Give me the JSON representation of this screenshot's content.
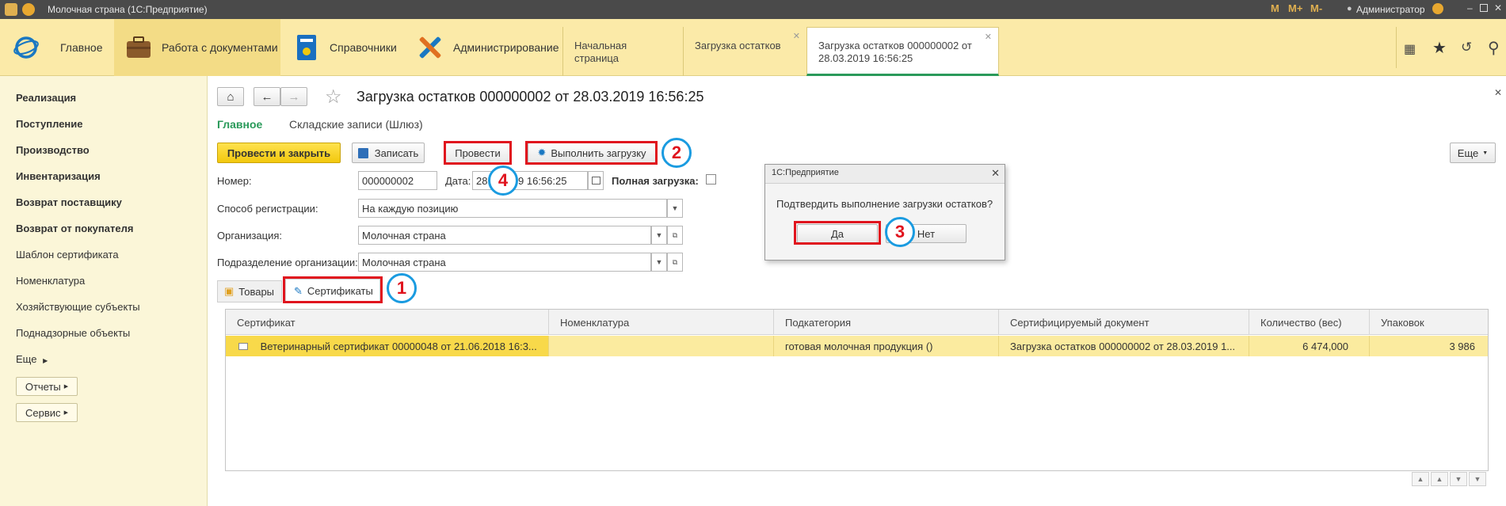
{
  "window": {
    "title": "Молочная страна  (1С:Предприятие)",
    "user": "Администратор",
    "toolbar_m": [
      "M",
      "M+",
      "M-"
    ]
  },
  "sections": [
    {
      "label": "Главное",
      "icon": "1c-logo-icon"
    },
    {
      "label": "Работа с документами",
      "icon": "briefcase-icon"
    },
    {
      "label": "Справочники",
      "icon": "reference-book-icon"
    },
    {
      "label": "Администрирование",
      "icon": "tools-icon"
    }
  ],
  "open_tabs": [
    {
      "label": "Начальная страница"
    },
    {
      "label": "Загрузка остатков"
    },
    {
      "label_line1": "Загрузка остатков 000000002 от",
      "label_line2": "28.03.2019 16:56:25"
    }
  ],
  "nav": {
    "items": [
      "Реализация",
      "Поступление",
      "Производство",
      "Инвентаризация",
      "Возврат поставщику",
      "Возврат от покупателя",
      "Шаблон сертификата",
      "Номенклатура",
      "Хозяйствующие субъекты",
      "Поднадзорные объекты",
      "Еще"
    ],
    "reports": "Отчеты",
    "service": "Сервис"
  },
  "doc": {
    "title": "Загрузка остатков 000000002 от 28.03.2019 16:56:25",
    "links": {
      "main": "Главное",
      "records": "Складские записи (Шлюз)"
    },
    "buttons": {
      "post_close": "Провести и закрыть",
      "save": "Записать",
      "post": "Провести",
      "run_load": "Выполнить загрузку",
      "more": "Еще"
    },
    "fields": {
      "number_label": "Номер:",
      "number_value": "000000002",
      "date_label": "Дата:",
      "date_value_left": "28",
      "date_value_right": "9 16:56:25",
      "full_load_label": "Полная загрузка:",
      "reg_label": "Способ регистрации:",
      "reg_value": "На каждую позицию",
      "org_label": "Организация:",
      "org_value": "Молочная страна",
      "dept_label": "Подразделение организации:",
      "dept_value": "Молочная страна"
    },
    "tabs": {
      "goods": "Товары",
      "certs": "Сертификаты"
    }
  },
  "table": {
    "columns": [
      "Сертификат",
      "Номенклатура",
      "Подкатегория",
      "Сертифицируемый документ",
      "Количество (вес)",
      "Упаковок"
    ],
    "rows": [
      {
        "cert": "Ветеринарный сертификат 00000048 от 21.06.2018 16:3...",
        "nom": "",
        "sub": "готовая молочная продукция ()",
        "doc": "Загрузка остатков 000000002 от 28.03.2019 1...",
        "qty": "6 474,000",
        "pack": "3 986"
      }
    ]
  },
  "dialog": {
    "title": "1С:Предприятие",
    "question": "Подтвердить выполнение загрузки остатков?",
    "yes": "Да",
    "no": "Нет"
  },
  "markers": [
    "1",
    "2",
    "3",
    "4"
  ],
  "colors": {
    "accent_yellow": "#f2c80e",
    "highlight_red": "#e0141e",
    "marker_blue": "#1a9be0",
    "active_green": "#2a9a5a"
  }
}
